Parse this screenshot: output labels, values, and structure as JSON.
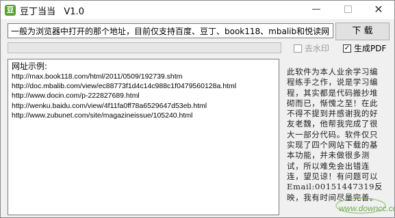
{
  "window": {
    "title": "豆丁当当   V1.0",
    "minimize_label": "—",
    "close_label": "✕",
    "icon": "app-icon"
  },
  "toolbar": {
    "url_value": "一般为浏览器中打开的那个地址，目前仅支持百度、豆丁、book118、mbalib和悦读网",
    "download_label": "下  载"
  },
  "progress": {
    "value": 0
  },
  "options": {
    "remove_watermark_label": "去水印",
    "remove_watermark_checked": false,
    "remove_watermark_enabled": false,
    "generate_pdf_label": "生成PDF",
    "generate_pdf_checked": true,
    "check_mark": "✓"
  },
  "examples": {
    "heading": "网址示例:",
    "urls": [
      "http://max.book118.com/html/2011/0509/192739.shtm",
      "http://doc.mbalib.com/view/ec88773f1d4c14c988c1f0479560128a.html",
      "http://www.docin.com/p-222827689.html",
      "http://wenku.baidu.com/view/4f11fa0ff78a6529647d53eb.html",
      "http://www.zubunet.com/site/magazineissue/105240.html"
    ]
  },
  "about": {
    "text": "此软件为本人业余学习编程练手之作，说是学习编程，其实都是代码搬抄堆砌而已，惭愧之至！在此不得不提到并感谢我的好友老魏，他帮我完成了很大一部分代码。软件仅只实现了四个网站下载的基本功能，并未做很多测试，所以难免会出错连连，望见谅！有问题可以Email:00151447319反映，我有时间尽量完善。"
  },
  "watermark": {
    "text": "www.downcc.com",
    "color": "#4d9a2a"
  }
}
